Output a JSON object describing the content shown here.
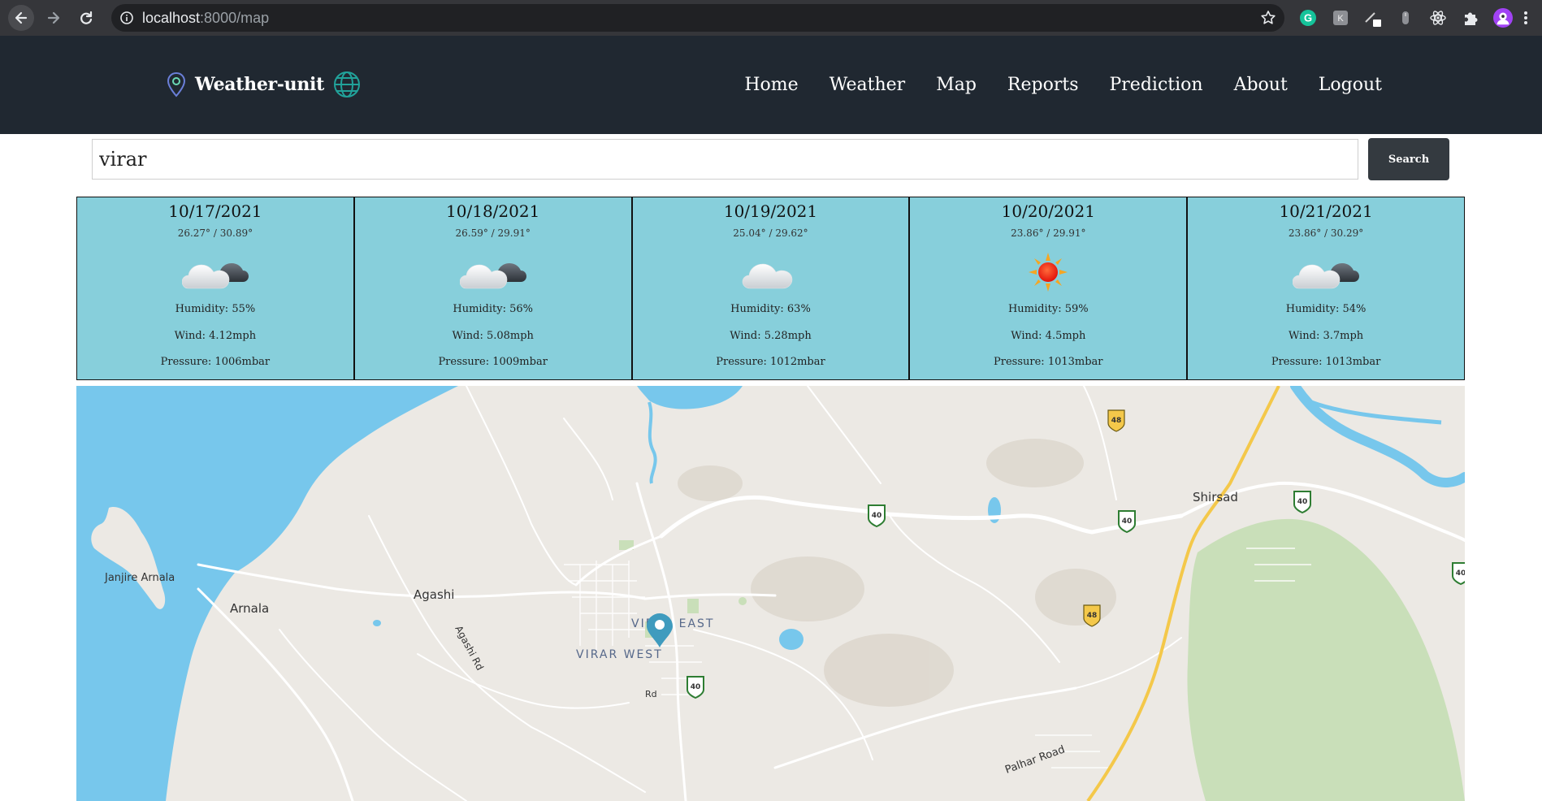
{
  "browser": {
    "url_host": "localhost",
    "url_path": ":8000/map",
    "icons": [
      "back-icon",
      "forward-icon",
      "reload-icon",
      "info-icon",
      "star-icon",
      "grammarly-icon",
      "extension-icon",
      "pen-icon",
      "mouse-icon",
      "react-icon",
      "puzzle-icon",
      "avatar",
      "menu-icon"
    ]
  },
  "header": {
    "brand_name": "Weather-unit",
    "nav": [
      "Home",
      "Weather",
      "Map",
      "Reports",
      "Prediction",
      "About",
      "Logout"
    ]
  },
  "search": {
    "value": "virar",
    "button_label": "Search"
  },
  "forecast": [
    {
      "date": "10/17/2021",
      "temp": "26.27° / 30.89°",
      "icon": "cloud-partly-icon",
      "humidity": "Humidity: 55%",
      "wind": "Wind: 4.12mph",
      "pressure": "Pressure: 1006mbar"
    },
    {
      "date": "10/18/2021",
      "temp": "26.59° / 29.91°",
      "icon": "cloud-partly-icon",
      "humidity": "Humidity: 56%",
      "wind": "Wind: 5.08mph",
      "pressure": "Pressure: 1009mbar"
    },
    {
      "date": "10/19/2021",
      "temp": "25.04° / 29.62°",
      "icon": "cloud-icon",
      "humidity": "Humidity: 63%",
      "wind": "Wind: 5.28mph",
      "pressure": "Pressure: 1012mbar"
    },
    {
      "date": "10/20/2021",
      "temp": "23.86° / 29.91°",
      "icon": "sun-icon",
      "humidity": "Humidity: 59%",
      "wind": "Wind: 4.5mph",
      "pressure": "Pressure: 1013mbar"
    },
    {
      "date": "10/21/2021",
      "temp": "23.86° / 30.29°",
      "icon": "cloud-partly-icon",
      "humidity": "Humidity: 54%",
      "wind": "Wind: 3.7mph",
      "pressure": "Pressure: 1013mbar"
    }
  ],
  "map": {
    "labels": {
      "janjire": "Janjire Arnala",
      "arnala": "Arnala",
      "agashi": "Agashi",
      "agashi_rd": "Agashi Rd",
      "virar_east": "VIRAR EAST",
      "virar_west": "VIRAR WEST",
      "rd": "Rd",
      "shirsad": "Shirsad",
      "palhar": "Palhar Road"
    },
    "shields": {
      "nh48": "48",
      "nh40": "40"
    },
    "colors": {
      "water": "#77c7ec",
      "land": "#ece9e4",
      "park": "#c9dfb9",
      "highway": "#f4c84a",
      "road": "#ffffff",
      "marker": "#3f9bbe"
    }
  }
}
